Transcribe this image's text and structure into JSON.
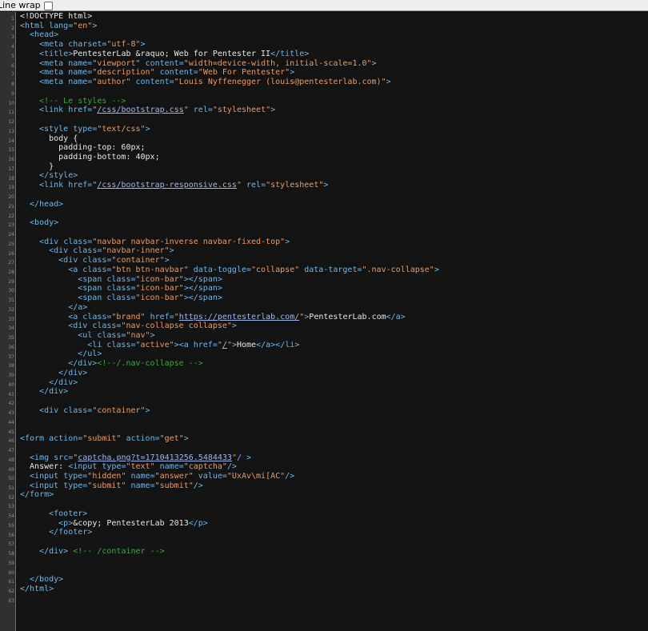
{
  "toolbar": {
    "line_wrap_label": "Line wrap",
    "line_wrap_checked": false
  },
  "line_count": 63,
  "lines": [
    [
      [
        "t",
        "<!DOCTYPE html>"
      ]
    ],
    [
      [
        "g",
        "<html "
      ],
      [
        "a",
        "lang="
      ],
      [
        "v",
        "\"en\""
      ],
      [
        "g",
        ">"
      ]
    ],
    [
      [
        "g",
        "  <head>"
      ]
    ],
    [
      [
        "g",
        "    <meta "
      ],
      [
        "a",
        "charset="
      ],
      [
        "v",
        "\"utf-8\""
      ],
      [
        "g",
        ">"
      ]
    ],
    [
      [
        "g",
        "    <title>"
      ],
      [
        "t",
        "PentesterLab &raquo; Web for Pentester II"
      ],
      [
        "g",
        "</title>"
      ]
    ],
    [
      [
        "g",
        "    <meta "
      ],
      [
        "a",
        "name="
      ],
      [
        "v",
        "\"viewport\" "
      ],
      [
        "a",
        "content="
      ],
      [
        "v",
        "\"width=device-width, initial-scale=1.0\""
      ],
      [
        "g",
        ">"
      ]
    ],
    [
      [
        "g",
        "    <meta "
      ],
      [
        "a",
        "name="
      ],
      [
        "v",
        "\"description\" "
      ],
      [
        "a",
        "content="
      ],
      [
        "v",
        "\"Web For Pentester\""
      ],
      [
        "g",
        ">"
      ]
    ],
    [
      [
        "g",
        "    <meta "
      ],
      [
        "a",
        "name="
      ],
      [
        "v",
        "\"author\" "
      ],
      [
        "a",
        "content="
      ],
      [
        "v",
        "\"Louis Nyffenegger (louis@pentesterlab.com)\""
      ],
      [
        "g",
        ">"
      ]
    ],
    [],
    [
      [
        "c",
        "    <!-- Le styles -->"
      ]
    ],
    [
      [
        "g",
        "    <link "
      ],
      [
        "a",
        "href="
      ],
      [
        "v",
        "\""
      ],
      [
        "l",
        "/css/bootstrap.css"
      ],
      [
        "v",
        "\" "
      ],
      [
        "a",
        "rel="
      ],
      [
        "v",
        "\"stylesheet\""
      ],
      [
        "g",
        ">"
      ]
    ],
    [],
    [
      [
        "g",
        "    <style "
      ],
      [
        "a",
        "type="
      ],
      [
        "v",
        "\"text/css\""
      ],
      [
        "g",
        ">"
      ]
    ],
    [
      [
        "t",
        "      body {"
      ]
    ],
    [
      [
        "t",
        "        padding-top: 60px;"
      ]
    ],
    [
      [
        "t",
        "        padding-bottom: 40px;"
      ]
    ],
    [
      [
        "t",
        "      }"
      ]
    ],
    [
      [
        "g",
        "    </style>"
      ]
    ],
    [
      [
        "g",
        "    <link "
      ],
      [
        "a",
        "href="
      ],
      [
        "v",
        "\""
      ],
      [
        "l",
        "/css/bootstrap-responsive.css"
      ],
      [
        "v",
        "\" "
      ],
      [
        "a",
        "rel="
      ],
      [
        "v",
        "\"stylesheet\""
      ],
      [
        "g",
        ">"
      ]
    ],
    [],
    [
      [
        "g",
        "  </head>"
      ]
    ],
    [],
    [
      [
        "g",
        "  <body>"
      ]
    ],
    [],
    [
      [
        "g",
        "    <div "
      ],
      [
        "a",
        "class="
      ],
      [
        "v",
        "\"navbar navbar-inverse navbar-fixed-top\""
      ],
      [
        "g",
        ">"
      ]
    ],
    [
      [
        "g",
        "      <div "
      ],
      [
        "a",
        "class="
      ],
      [
        "v",
        "\"navbar-inner\""
      ],
      [
        "g",
        ">"
      ]
    ],
    [
      [
        "g",
        "        <div "
      ],
      [
        "a",
        "class="
      ],
      [
        "v",
        "\"container\""
      ],
      [
        "g",
        ">"
      ]
    ],
    [
      [
        "g",
        "          <a "
      ],
      [
        "a",
        "class="
      ],
      [
        "v",
        "\"btn btn-navbar\" "
      ],
      [
        "a",
        "data-toggle="
      ],
      [
        "v",
        "\"collapse\" "
      ],
      [
        "a",
        "data-target="
      ],
      [
        "v",
        "\".nav-collapse\""
      ],
      [
        "g",
        ">"
      ]
    ],
    [
      [
        "g",
        "            <span "
      ],
      [
        "a",
        "class="
      ],
      [
        "v",
        "\"icon-bar\""
      ],
      [
        "g",
        "></span>"
      ]
    ],
    [
      [
        "g",
        "            <span "
      ],
      [
        "a",
        "class="
      ],
      [
        "v",
        "\"icon-bar\""
      ],
      [
        "g",
        "></span>"
      ]
    ],
    [
      [
        "g",
        "            <span "
      ],
      [
        "a",
        "class="
      ],
      [
        "v",
        "\"icon-bar\""
      ],
      [
        "g",
        "></span>"
      ]
    ],
    [
      [
        "g",
        "          </a>"
      ]
    ],
    [
      [
        "g",
        "          <a "
      ],
      [
        "a",
        "class="
      ],
      [
        "v",
        "\"brand\" "
      ],
      [
        "a",
        "href="
      ],
      [
        "v",
        "\""
      ],
      [
        "l",
        "https://pentesterlab.com/"
      ],
      [
        "v",
        "\""
      ],
      [
        "g",
        ">"
      ],
      [
        "t",
        "PentesterLab.com"
      ],
      [
        "g",
        "</a>"
      ]
    ],
    [
      [
        "g",
        "          <div "
      ],
      [
        "a",
        "class="
      ],
      [
        "v",
        "\"nav-collapse collapse\""
      ],
      [
        "g",
        ">"
      ]
    ],
    [
      [
        "g",
        "            <ul "
      ],
      [
        "a",
        "class="
      ],
      [
        "v",
        "\"nav\""
      ],
      [
        "g",
        ">"
      ]
    ],
    [
      [
        "g",
        "              <li "
      ],
      [
        "a",
        "class="
      ],
      [
        "v",
        "\"active\""
      ],
      [
        "g",
        "><a "
      ],
      [
        "a",
        "href="
      ],
      [
        "v",
        "\""
      ],
      [
        "l",
        "/"
      ],
      [
        "v",
        "\""
      ],
      [
        "g",
        ">"
      ],
      [
        "t",
        "Home"
      ],
      [
        "g",
        "</a></li>"
      ]
    ],
    [
      [
        "g",
        "            </ul>"
      ]
    ],
    [
      [
        "g",
        "          </div>"
      ],
      [
        "c",
        "<!--/.nav-collapse -->"
      ]
    ],
    [
      [
        "g",
        "        </div>"
      ]
    ],
    [
      [
        "g",
        "      </div>"
      ]
    ],
    [
      [
        "g",
        "    </div>"
      ]
    ],
    [],
    [
      [
        "g",
        "    <div "
      ],
      [
        "a",
        "class="
      ],
      [
        "v",
        "\"container\""
      ],
      [
        "g",
        ">"
      ]
    ],
    [],
    [],
    [
      [
        "g",
        "<form "
      ],
      [
        "a",
        "action="
      ],
      [
        "v",
        "\"submit\" "
      ],
      [
        "a",
        "action="
      ],
      [
        "v",
        "\"get\""
      ],
      [
        "g",
        ">"
      ]
    ],
    [],
    [
      [
        "g",
        "  <img "
      ],
      [
        "a",
        "src="
      ],
      [
        "v",
        "\""
      ],
      [
        "l",
        "captcha.png?t=1710413256.5484433"
      ],
      [
        "v",
        "\""
      ],
      [
        "g",
        "/ >"
      ]
    ],
    [
      [
        "t",
        "  Answer: "
      ],
      [
        "g",
        "<input "
      ],
      [
        "a",
        "type="
      ],
      [
        "v",
        "\"text\" "
      ],
      [
        "a",
        "name="
      ],
      [
        "v",
        "\"captcha\""
      ],
      [
        "g",
        "/>"
      ]
    ],
    [
      [
        "g",
        "  <input "
      ],
      [
        "a",
        "type="
      ],
      [
        "v",
        "\"hidden\" "
      ],
      [
        "a",
        "name="
      ],
      [
        "v",
        "\"answer\" "
      ],
      [
        "a",
        "value="
      ],
      [
        "v",
        "\"UxAv\\mi[AC\""
      ],
      [
        "g",
        "/>"
      ]
    ],
    [
      [
        "g",
        "  <input "
      ],
      [
        "a",
        "type="
      ],
      [
        "v",
        "\"submit\" "
      ],
      [
        "a",
        "name="
      ],
      [
        "v",
        "\"submit\""
      ],
      [
        "g",
        "/>"
      ]
    ],
    [
      [
        "g",
        "</form>"
      ]
    ],
    [],
    [
      [
        "g",
        "      <footer>"
      ]
    ],
    [
      [
        "g",
        "        <p>"
      ],
      [
        "t",
        "&copy; PentesterLab 2013"
      ],
      [
        "g",
        "</p>"
      ]
    ],
    [
      [
        "g",
        "      </footer>"
      ]
    ],
    [],
    [
      [
        "g",
        "    </div> "
      ],
      [
        "c",
        "<!-- /container -->"
      ]
    ],
    [],
    [],
    [
      [
        "g",
        "  </body>"
      ]
    ],
    [
      [
        "g",
        "</html>"
      ]
    ],
    []
  ],
  "colors": {
    "background": "#131313",
    "gutter": "#303030",
    "tag": "#6eb6e6",
    "attribute": "#6eb6e6",
    "value": "#e99a5e",
    "text": "#e6e6e6",
    "comment": "#3fa43f",
    "link": "#a0b4e8"
  }
}
